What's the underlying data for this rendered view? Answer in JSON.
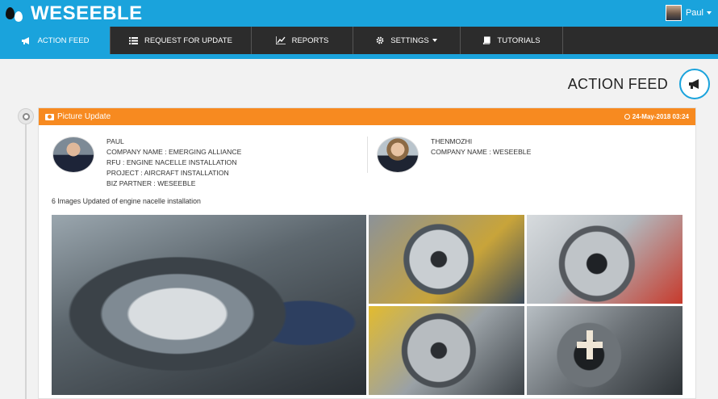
{
  "app": {
    "brand": "WESEEBLE",
    "user_name": "Paul"
  },
  "nav": [
    {
      "label": "ACTION FEED",
      "icon": "bullhorn-icon",
      "active": true
    },
    {
      "label": "REQUEST FOR UPDATE",
      "icon": "list-icon",
      "active": false
    },
    {
      "label": "REPORTS",
      "icon": "chart-icon",
      "active": false
    },
    {
      "label": "SETTINGS",
      "icon": "gear-icon",
      "active": false,
      "dropdown": true
    },
    {
      "label": "TUTORIALS",
      "icon": "book-icon",
      "active": false
    }
  ],
  "page": {
    "title": "ACTION FEED",
    "icon": "bullhorn-icon"
  },
  "feed_item": {
    "type": "Picture Update",
    "timestamp": "24-May-2018 03:24",
    "sender": {
      "name": "PAUL",
      "company": "COMPANY NAME : EMERGING ALLIANCE",
      "rfu": "RFU : ENGINE NACELLE INSTALLATION",
      "project": "PROJECT : AIRCRAFT INSTALLATION",
      "biz_partner": "BIZ PARTNER : WESEEBLE"
    },
    "recipient": {
      "name": "THENMOZHI",
      "company": "COMPANY NAME : WESEEBLE"
    },
    "description": "6 Images Updated of engine nacelle installation"
  },
  "colors": {
    "brand_blue": "#1aa3dc",
    "nav_dark": "#2c2c2c",
    "card_header_orange": "#f78a20"
  }
}
